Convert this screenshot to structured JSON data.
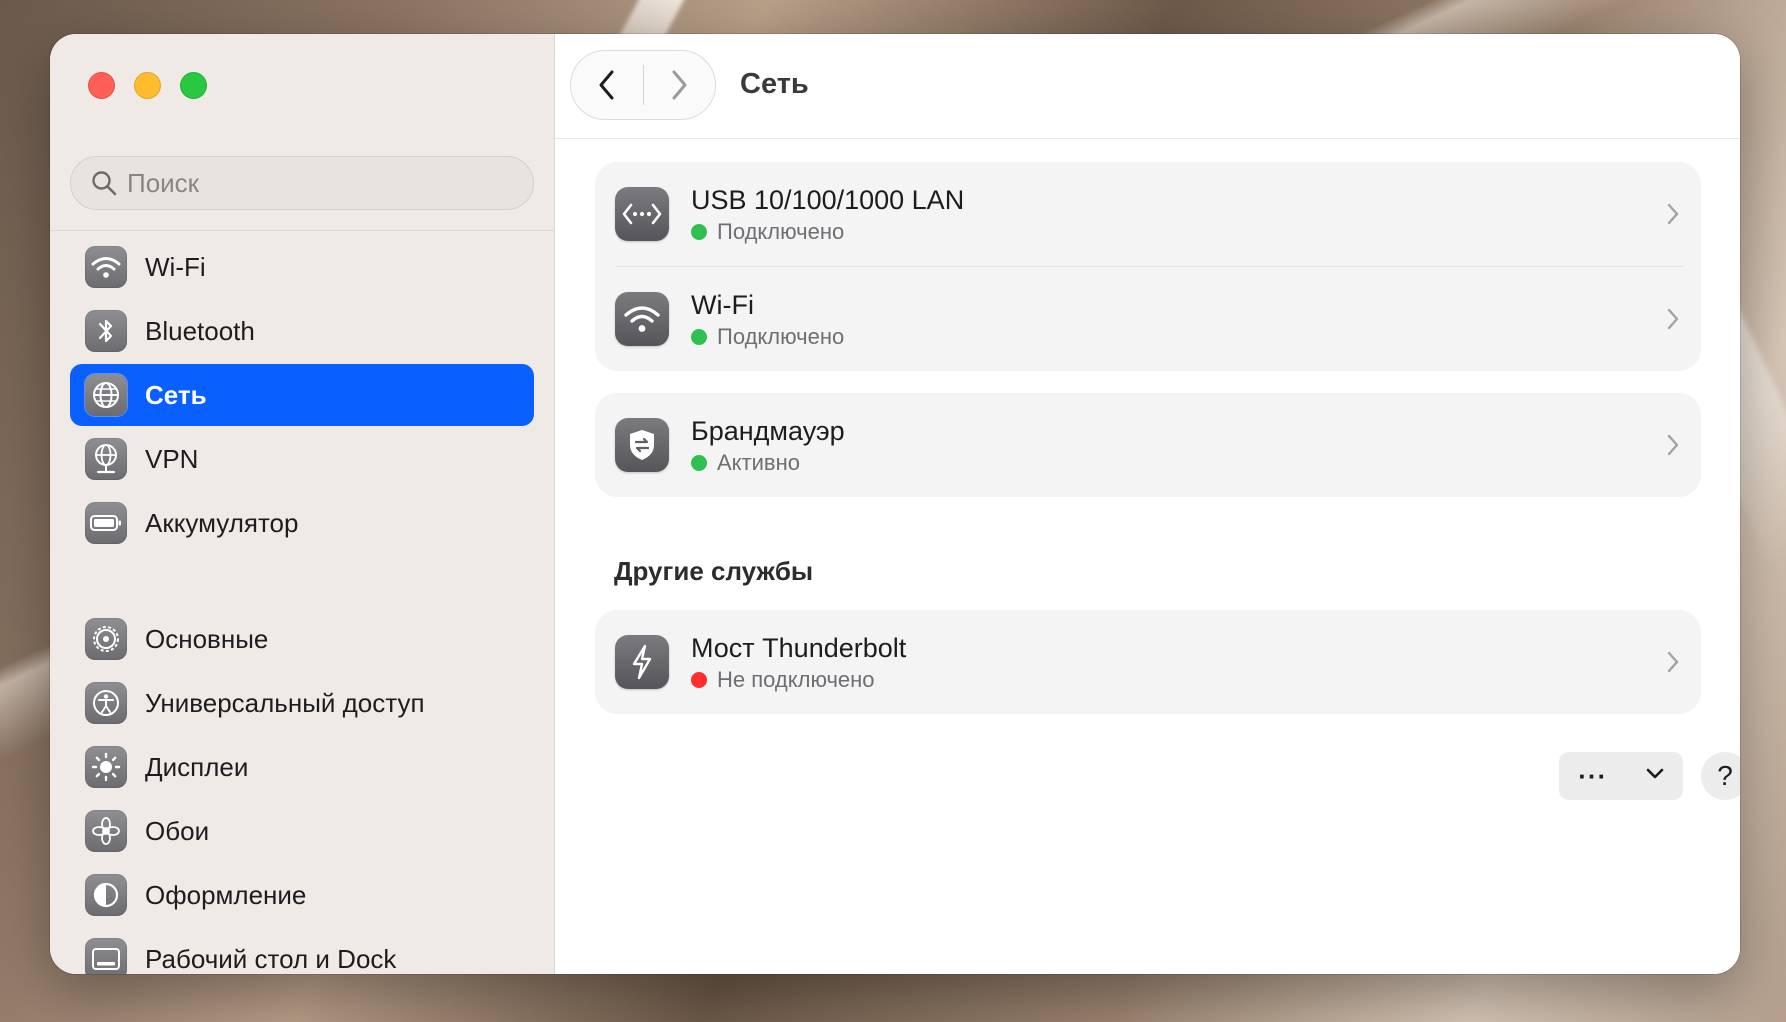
{
  "window": {
    "title": "Сеть"
  },
  "search": {
    "placeholder": "Поиск"
  },
  "sidebar": {
    "items": [
      {
        "label": "Wi-Fi",
        "icon": "wifi-icon"
      },
      {
        "label": "Bluetooth",
        "icon": "bluetooth-icon"
      },
      {
        "label": "Сеть",
        "icon": "globe-icon",
        "selected": true
      },
      {
        "label": "VPN",
        "icon": "vpn-globe-icon"
      },
      {
        "label": "Аккумулятор",
        "icon": "battery-icon"
      },
      {
        "label": "Основные",
        "icon": "gear-icon"
      },
      {
        "label": "Универсальный доступ",
        "icon": "accessibility-icon"
      },
      {
        "label": "Дисплеи",
        "icon": "brightness-icon"
      },
      {
        "label": "Обои",
        "icon": "flower-icon"
      },
      {
        "label": "Оформление",
        "icon": "appearance-icon"
      },
      {
        "label": "Рабочий стол и Dock",
        "icon": "dock-icon"
      }
    ]
  },
  "services": [
    {
      "title": "USB 10/100/1000 LAN",
      "status": "Подключено",
      "status_color": "#30c04f",
      "icon": "ethernet-icon"
    },
    {
      "title": "Wi-Fi",
      "status": "Подключено",
      "status_color": "#30c04f",
      "icon": "wifi-icon"
    }
  ],
  "firewall": {
    "title": "Брандмауэр",
    "status": "Активно",
    "status_color": "#30c04f",
    "icon": "firewall-shield-icon"
  },
  "other_services": {
    "heading": "Другие службы",
    "items": [
      {
        "title": "Мост Thunderbolt",
        "status": "Не подключено",
        "status_color": "#ff2d2d",
        "icon": "thunderbolt-icon"
      }
    ]
  },
  "footer": {
    "more_label": "···",
    "help_label": "?"
  },
  "colors": {
    "accent": "#0a5fff",
    "connected": "#30c04f",
    "disconnected": "#ff2d2d"
  }
}
